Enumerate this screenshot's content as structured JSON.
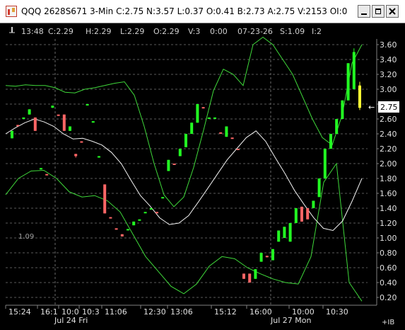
{
  "window": {
    "title": "QQQ 2628S671 3-Min C:2.75 N:3.57 L:0.37 O:0.41 B:2.73 A:2.75 V:2153 OI:0",
    "app_icon": "chart-app-icon",
    "buttons": [
      "minimize-icon",
      "maximize-icon",
      "close-icon"
    ]
  },
  "infobar": {
    "pin_icon": "pin-icon",
    "time": "13:48",
    "close": "C:2.29",
    "high": "H:2.29",
    "low": "L:2.29",
    "open": "O:2.29",
    "volume": "V:3",
    "duration": "0:00",
    "date": "07-23-26",
    "strike": "S:1.09",
    "interval": "I:2"
  },
  "chart_data": {
    "type": "bar",
    "yaxis": {
      "ticks": [
        "3.60",
        "3.40",
        "3.20",
        "3.00",
        "2.80",
        "2.60",
        "2.40",
        "2.20",
        "2.00",
        "1.80",
        "1.60",
        "1.40",
        "1.20",
        "1.00",
        "0.80",
        "0.60",
        "0.40",
        "0.20"
      ],
      "ylim": [
        0.15,
        3.65
      ]
    },
    "last_price": "2.75",
    "strike_label": "1.09",
    "xaxis": {
      "time_labels": [
        "15:24",
        "16:1",
        "10:0",
        "10:3",
        "11:06",
        "12:30",
        "13:06",
        "15:12",
        "16:00",
        "10:00",
        "10:30"
      ],
      "date_labels": [
        "Jul 24 Fri",
        "Jul 27 Mon"
      ],
      "corner_label": "+IB"
    },
    "candles": [
      {
        "o": 2.34,
        "c": 2.44,
        "h": 2.44,
        "l": 2.34,
        "color": "green"
      },
      {
        "o": 2.52,
        "c": 2.52,
        "h": 2.52,
        "l": 2.52,
        "color": "red"
      },
      {
        "o": 2.62,
        "c": 2.62,
        "h": 2.62,
        "l": 2.62,
        "color": "green"
      },
      {
        "o": 2.73,
        "c": 2.66,
        "h": 2.73,
        "l": 2.66,
        "color": "green"
      },
      {
        "o": 2.62,
        "c": 2.44,
        "h": 2.62,
        "l": 2.44,
        "color": "red"
      },
      {
        "o": 1.94,
        "c": 1.94,
        "h": 1.94,
        "l": 1.94,
        "color": "green"
      },
      {
        "o": 1.86,
        "c": 1.86,
        "h": 1.86,
        "l": 1.86,
        "color": "red"
      },
      {
        "o": 2.75,
        "c": 2.78,
        "h": 2.78,
        "l": 2.75,
        "color": "green"
      },
      {
        "o": 2.66,
        "c": 2.66,
        "h": 2.66,
        "l": 2.66,
        "color": "red"
      },
      {
        "o": 2.66,
        "c": 2.44,
        "h": 2.66,
        "l": 2.44,
        "color": "red"
      },
      {
        "o": 2.44,
        "c": 2.5,
        "h": 2.5,
        "l": 2.44,
        "color": "green"
      },
      {
        "o": 2.13,
        "c": 2.1,
        "h": 2.13,
        "l": 2.08,
        "color": "red"
      },
      {
        "o": 2.3,
        "c": 2.3,
        "h": 2.3,
        "l": 2.3,
        "color": "red"
      },
      {
        "o": 2.8,
        "c": 2.8,
        "h": 2.8,
        "l": 2.8,
        "color": "green"
      },
      {
        "o": 2.57,
        "c": 2.57,
        "h": 2.57,
        "l": 2.57,
        "color": "green"
      },
      {
        "o": 2.1,
        "c": 2.1,
        "h": 2.1,
        "l": 2.1,
        "color": "green"
      },
      {
        "o": 1.72,
        "c": 1.33,
        "h": 1.72,
        "l": 1.33,
        "color": "red"
      },
      {
        "o": 1.28,
        "c": 1.28,
        "h": 1.28,
        "l": 1.28,
        "color": "red"
      },
      {
        "o": 1.13,
        "c": 1.13,
        "h": 1.13,
        "l": 1.13,
        "color": "red"
      },
      {
        "o": 1.05,
        "c": 1.02,
        "h": 1.05,
        "l": 1.02,
        "color": "red"
      },
      {
        "o": 1.12,
        "c": 1.12,
        "h": 1.12,
        "l": 1.12,
        "color": "green"
      },
      {
        "o": 1.17,
        "c": 1.22,
        "h": 1.22,
        "l": 1.17,
        "color": "green"
      },
      {
        "o": 1.25,
        "c": 1.25,
        "h": 1.25,
        "l": 1.25,
        "color": "green"
      },
      {
        "o": 1.35,
        "c": 1.35,
        "h": 1.35,
        "l": 1.35,
        "color": "green"
      },
      {
        "o": 1.4,
        "c": 1.4,
        "h": 1.4,
        "l": 1.4,
        "color": "green"
      },
      {
        "o": 1.35,
        "c": 1.35,
        "h": 1.35,
        "l": 1.35,
        "color": "red"
      },
      {
        "o": 1.55,
        "c": 1.55,
        "h": 1.55,
        "l": 1.55,
        "color": "green"
      },
      {
        "o": 1.9,
        "c": 2.05,
        "h": 2.05,
        "l": 1.9,
        "color": "green"
      },
      {
        "o": 2.0,
        "c": 2.0,
        "h": 2.0,
        "l": 2.0,
        "color": "red"
      },
      {
        "o": 2.1,
        "c": 2.2,
        "h": 2.2,
        "l": 2.1,
        "color": "green"
      },
      {
        "o": 2.22,
        "c": 2.4,
        "h": 2.4,
        "l": 2.22,
        "color": "green"
      },
      {
        "o": 2.4,
        "c": 2.55,
        "h": 2.55,
        "l": 2.4,
        "color": "green"
      },
      {
        "o": 2.55,
        "c": 2.8,
        "h": 2.8,
        "l": 2.55,
        "color": "green"
      },
      {
        "o": 2.76,
        "c": 2.76,
        "h": 2.76,
        "l": 2.76,
        "color": "red"
      },
      {
        "o": 2.62,
        "c": 2.62,
        "h": 2.62,
        "l": 2.62,
        "color": "green"
      },
      {
        "o": 2.62,
        "c": 2.62,
        "h": 2.62,
        "l": 2.62,
        "color": "green"
      },
      {
        "o": 2.42,
        "c": 2.42,
        "h": 2.42,
        "l": 2.42,
        "color": "red"
      },
      {
        "o": 2.36,
        "c": 2.5,
        "h": 2.5,
        "l": 2.36,
        "color": "green"
      },
      {
        "o": 2.35,
        "c": 2.35,
        "h": 2.35,
        "l": 2.35,
        "color": "red"
      },
      {
        "o": 2.2,
        "c": 2.2,
        "h": 2.2,
        "l": 2.2,
        "color": "red"
      },
      {
        "o": 0.45,
        "c": 0.52,
        "h": 0.52,
        "l": 0.45,
        "color": "red"
      },
      {
        "o": 0.4,
        "c": 0.52,
        "h": 0.52,
        "l": 0.4,
        "color": "red"
      },
      {
        "o": 0.45,
        "c": 0.58,
        "h": 0.58,
        "l": 0.45,
        "color": "green"
      },
      {
        "o": 0.68,
        "c": 0.8,
        "h": 0.8,
        "l": 0.68,
        "color": "green"
      },
      {
        "o": 0.74,
        "c": 0.76,
        "h": 0.76,
        "l": 0.74,
        "color": "red"
      },
      {
        "o": 0.7,
        "c": 0.85,
        "h": 0.85,
        "l": 0.7,
        "color": "green"
      },
      {
        "o": 0.95,
        "c": 1.1,
        "h": 1.1,
        "l": 0.95,
        "color": "green"
      },
      {
        "o": 1.0,
        "c": 1.15,
        "h": 1.15,
        "l": 1.0,
        "color": "green"
      },
      {
        "o": 0.95,
        "c": 1.2,
        "h": 1.2,
        "l": 0.95,
        "color": "green"
      },
      {
        "o": 1.2,
        "c": 1.4,
        "h": 1.4,
        "l": 1.2,
        "color": "green"
      },
      {
        "o": 1.42,
        "c": 1.22,
        "h": 1.42,
        "l": 1.22,
        "color": "red"
      },
      {
        "o": 1.4,
        "c": 1.25,
        "h": 1.4,
        "l": 1.25,
        "color": "red"
      },
      {
        "o": 1.4,
        "c": 1.5,
        "h": 1.5,
        "l": 1.4,
        "color": "green"
      },
      {
        "o": 1.55,
        "c": 1.8,
        "h": 1.8,
        "l": 1.55,
        "color": "green"
      },
      {
        "o": 1.8,
        "c": 2.2,
        "h": 2.2,
        "l": 1.8,
        "color": "green"
      },
      {
        "o": 2.2,
        "c": 2.4,
        "h": 2.4,
        "l": 2.2,
        "color": "green"
      },
      {
        "o": 2.4,
        "c": 2.6,
        "h": 2.6,
        "l": 2.4,
        "color": "green"
      },
      {
        "o": 2.6,
        "c": 2.85,
        "h": 2.85,
        "l": 2.6,
        "color": "green"
      },
      {
        "o": 2.85,
        "c": 3.35,
        "h": 3.35,
        "l": 2.85,
        "color": "green"
      },
      {
        "o": 3.0,
        "c": 3.5,
        "h": 3.55,
        "l": 3.0,
        "color": "green"
      },
      {
        "o": 3.05,
        "c": 2.75,
        "h": 3.1,
        "l": 2.72,
        "color": "yellow"
      }
    ],
    "middle_band": [
      2.4,
      2.48,
      2.55,
      2.6,
      2.56,
      2.5,
      2.4,
      2.33,
      2.34,
      2.3,
      2.25,
      2.15,
      2.0,
      1.78,
      1.57,
      1.43,
      1.27,
      1.18,
      1.2,
      1.3,
      1.48,
      1.67,
      1.86,
      2.05,
      2.2,
      2.35,
      2.44,
      2.3,
      2.08,
      1.87,
      1.64,
      1.45,
      1.27,
      1.13,
      1.1,
      1.23,
      1.5,
      1.8
    ],
    "upper_band": [
      3.05,
      3.04,
      3.06,
      3.05,
      3.05,
      3.02,
      2.96,
      2.95,
      3.0,
      3.02,
      3.05,
      3.08,
      3.1,
      2.92,
      2.5,
      2.0,
      1.58,
      1.42,
      1.55,
      1.95,
      2.45,
      2.98,
      3.27,
      3.2,
      3.05,
      3.6,
      3.7,
      3.6,
      3.4,
      3.2,
      2.9,
      2.6,
      2.35,
      2.25,
      2.65,
      3.35,
      3.6
    ],
    "lower_band": [
      1.58,
      1.8,
      1.9,
      1.91,
      1.8,
      1.62,
      1.55,
      1.57,
      1.5,
      1.35,
      1.05,
      0.75,
      0.55,
      0.35,
      0.25,
      0.38,
      0.62,
      0.75,
      0.72,
      0.6,
      0.52,
      0.45,
      0.4,
      0.38,
      0.75,
      1.75,
      2.0,
      0.4,
      0.15
    ]
  }
}
